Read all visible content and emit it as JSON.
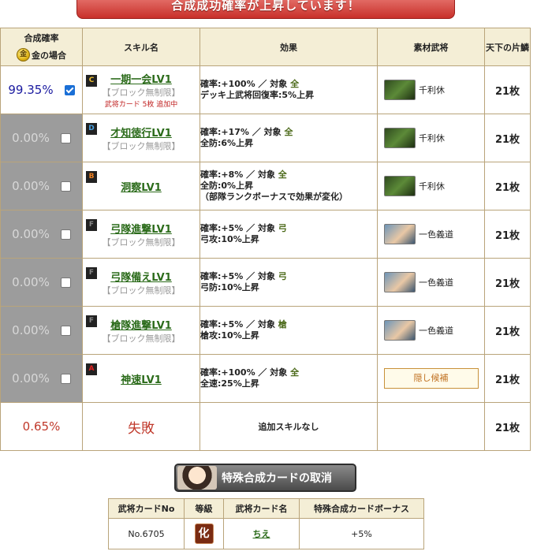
{
  "banner": "合成成功確率が上昇しています！",
  "headers": {
    "rate": "合成確率",
    "gold": "金の場合",
    "gold_icon_text": "金",
    "skill": "スキル名",
    "effect": "効果",
    "material": "素材武将",
    "tenka": "天下の片鱗"
  },
  "rows": [
    {
      "rate": "99.35%",
      "checked": true,
      "grade": "C",
      "grade_color": "#f0c030",
      "skill": "一期一会LV1",
      "note": "【ブロック無制限】",
      "extra": "武将カード 5枚 追加中",
      "effect1": "確率:+100% ／ 対象 ",
      "target": "全",
      "effect2": "デッキ上武将回復率:5%上昇",
      "effect3": "",
      "material": "千利休",
      "portrait": "green",
      "count": "21枚"
    },
    {
      "rate": "0.00%",
      "checked": false,
      "grade": "D",
      "grade_color": "#4aa0e0",
      "skill": "才知徳行LV1",
      "note": "【ブロック無制限】",
      "extra": "",
      "effect1": "確率:+17% ／ 対象 ",
      "target": "全",
      "effect2": "全防:6%上昇",
      "effect3": "",
      "material": "千利休",
      "portrait": "green",
      "count": "21枚"
    },
    {
      "rate": "0.00%",
      "checked": false,
      "grade": "B",
      "grade_color": "#f08020",
      "skill": "洞察LV1",
      "note": "",
      "extra": "",
      "effect1": "確率:+8% ／ 対象 ",
      "target": "全",
      "effect2": "全防:0%上昇",
      "effect3": "（部隊ランクボーナスで効果が変化）",
      "material": "千利休",
      "portrait": "green",
      "count": "21枚"
    },
    {
      "rate": "0.00%",
      "checked": false,
      "grade": "F",
      "grade_color": "#888888",
      "skill": "弓隊進撃LV1",
      "note": "【ブロック無制限】",
      "extra": "",
      "effect1": "確率:+5% ／ 対象 ",
      "target": "弓",
      "effect2": "弓攻:10%上昇",
      "effect3": "",
      "material": "一色義道",
      "portrait": "face",
      "count": "21枚"
    },
    {
      "rate": "0.00%",
      "checked": false,
      "grade": "F",
      "grade_color": "#888888",
      "skill": "弓隊備えLV1",
      "note": "【ブロック無制限】",
      "extra": "",
      "effect1": "確率:+5% ／ 対象 ",
      "target": "弓",
      "effect2": "弓防:10%上昇",
      "effect3": "",
      "material": "一色義道",
      "portrait": "face",
      "count": "21枚"
    },
    {
      "rate": "0.00%",
      "checked": false,
      "grade": "F",
      "grade_color": "#888888",
      "skill": "槍隊進撃LV1",
      "note": "【ブロック無制限】",
      "extra": "",
      "effect1": "確率:+5% ／ 対象 ",
      "target": "槍",
      "effect2": "槍攻:10%上昇",
      "effect3": "",
      "material": "一色義道",
      "portrait": "face",
      "count": "21枚"
    },
    {
      "rate": "0.00%",
      "checked": false,
      "grade": "A",
      "grade_color": "#e02020",
      "skill": "神速LV1",
      "note": "",
      "extra": "",
      "effect1": "確率:+100% ／ 対象 ",
      "target": "全",
      "effect2": "全速:25%上昇",
      "effect3": "",
      "material": "",
      "hidden_label": "隠し候補",
      "portrait": "none",
      "count": "21枚"
    }
  ],
  "fail_row": {
    "rate": "0.65%",
    "label": "失敗",
    "effect": "追加スキルなし",
    "count": "21枚"
  },
  "cancel_button": "特殊合成カードの取消",
  "card_table": {
    "headers": [
      "武将カードNo",
      "等級",
      "武将カード名",
      "特殊合成カードボーナス"
    ],
    "no": "No.6705",
    "grade": "化",
    "name": "ちえ",
    "bonus": "+5%"
  }
}
